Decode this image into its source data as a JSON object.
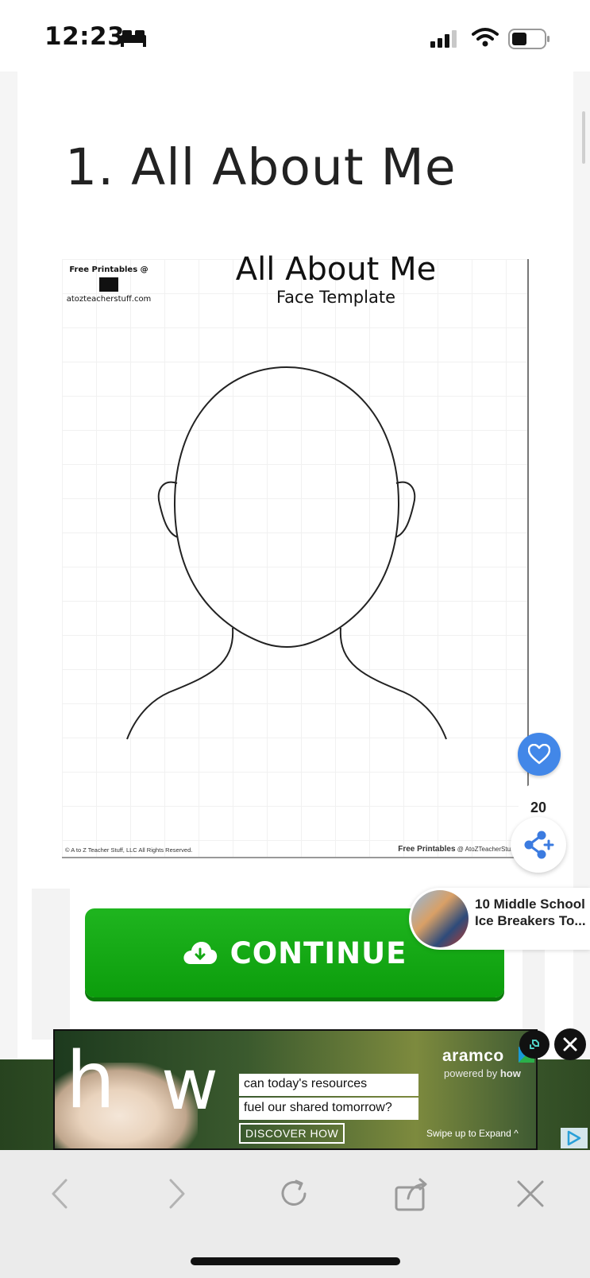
{
  "status_bar": {
    "time": "12:23"
  },
  "article": {
    "heading": "1. All About Me"
  },
  "printable": {
    "credit_line1": "Free Printables @",
    "credit_site": "atozteacherstuff.com",
    "title": "All About Me",
    "subtitle": "Face Template",
    "footer_left": "© A to Z Teacher Stuff, LLC   All Rights Reserved.",
    "footer_right_bold": "Free Printables",
    "footer_right": "@ AtoZTeacherStuff.co"
  },
  "continue_button": {
    "label": "CONTINUE"
  },
  "social": {
    "share_count": "20"
  },
  "related": {
    "title": "10 Middle School Ice Breakers To..."
  },
  "ad": {
    "big_h": "h",
    "big_w": "w",
    "line1": "can today's resources",
    "line2": "fuel our shared tomorrow?",
    "cta": "DISCOVER HOW",
    "brand": "aramco",
    "powered_prefix": "powered by",
    "powered_brand": "how",
    "swipe": "Swipe up to Expand ^"
  },
  "colors": {
    "continue_green": "#14a814",
    "like_blue": "#4287e8",
    "share_blue": "#3b7be0"
  },
  "icons": [
    "bed-icon",
    "signal-icon",
    "wifi-icon",
    "battery-icon",
    "heart-icon",
    "share-icon",
    "cloud-download-icon",
    "close-icon",
    "adchoices-icon",
    "back-icon",
    "forward-icon",
    "reload-icon",
    "share-out-icon"
  ]
}
